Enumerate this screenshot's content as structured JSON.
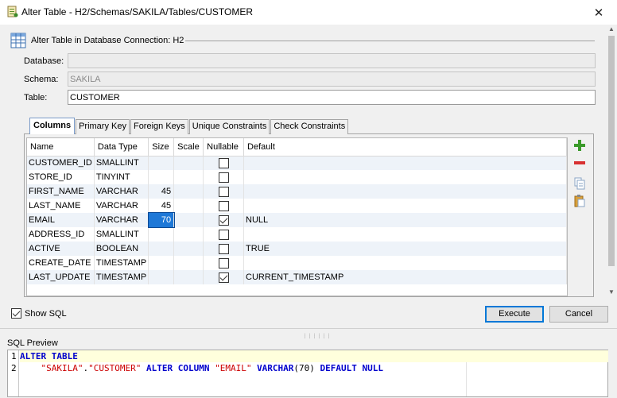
{
  "window": {
    "title": "Alter Table - H2/Schemas/SAKILA/Tables/CUSTOMER"
  },
  "header": {
    "text": "Alter Table in Database Connection: H2"
  },
  "form": {
    "database_label": "Database:",
    "database_value": "",
    "schema_label": "Schema:",
    "schema_value": "SAKILA",
    "table_label": "Table:",
    "table_value": "CUSTOMER"
  },
  "tabs": [
    {
      "label": "Columns",
      "active": true
    },
    {
      "label": "Primary Key",
      "active": false
    },
    {
      "label": "Foreign Keys",
      "active": false
    },
    {
      "label": "Unique Constraints",
      "active": false
    },
    {
      "label": "Check Constraints",
      "active": false
    }
  ],
  "columns_table": {
    "headers": [
      "Name",
      "Data Type",
      "Size",
      "Scale",
      "Nullable",
      "Default"
    ],
    "rows": [
      {
        "name": "CUSTOMER_ID",
        "type": "SMALLINT",
        "size": "",
        "scale": "",
        "nullable": false,
        "default": ""
      },
      {
        "name": "STORE_ID",
        "type": "TINYINT",
        "size": "",
        "scale": "",
        "nullable": false,
        "default": ""
      },
      {
        "name": "FIRST_NAME",
        "type": "VARCHAR",
        "size": "45",
        "scale": "",
        "nullable": false,
        "default": ""
      },
      {
        "name": "LAST_NAME",
        "type": "VARCHAR",
        "size": "45",
        "scale": "",
        "nullable": false,
        "default": ""
      },
      {
        "name": "EMAIL",
        "type": "VARCHAR",
        "size": "70",
        "scale": "",
        "nullable": true,
        "default": "NULL",
        "size_selected": true
      },
      {
        "name": "ADDRESS_ID",
        "type": "SMALLINT",
        "size": "",
        "scale": "",
        "nullable": false,
        "default": ""
      },
      {
        "name": "ACTIVE",
        "type": "BOOLEAN",
        "size": "",
        "scale": "",
        "nullable": false,
        "default": "TRUE"
      },
      {
        "name": "CREATE_DATE",
        "type": "TIMESTAMP",
        "size": "",
        "scale": "",
        "nullable": false,
        "default": ""
      },
      {
        "name": "LAST_UPDATE",
        "type": "TIMESTAMP",
        "size": "",
        "scale": "",
        "nullable": true,
        "default": "CURRENT_TIMESTAMP"
      }
    ]
  },
  "toolbar": {
    "icons": [
      "add-icon",
      "remove-icon",
      "copy-icon",
      "paste-icon"
    ]
  },
  "footer": {
    "show_sql_label": "Show SQL",
    "show_sql_checked": true,
    "execute_label": "Execute",
    "cancel_label": "Cancel"
  },
  "sql_preview": {
    "label": "SQL Preview",
    "line_numbers": [
      "1",
      "2"
    ],
    "line1": "ALTER TABLE",
    "line2_schema": "\"SAKILA\"",
    "line2_dot": ".",
    "line2_table": "\"CUSTOMER\"",
    "line2_kw1": "ALTER COLUMN",
    "line2_col": "\"EMAIL\"",
    "line2_kw2": "VARCHAR",
    "line2_size": "(70)",
    "line2_kw3": "DEFAULT NULL"
  },
  "colors": {
    "selection": "#1e78d7",
    "keyword": "#0000cc",
    "string": "#cc0000",
    "highlight_line": "#ffffdc"
  }
}
